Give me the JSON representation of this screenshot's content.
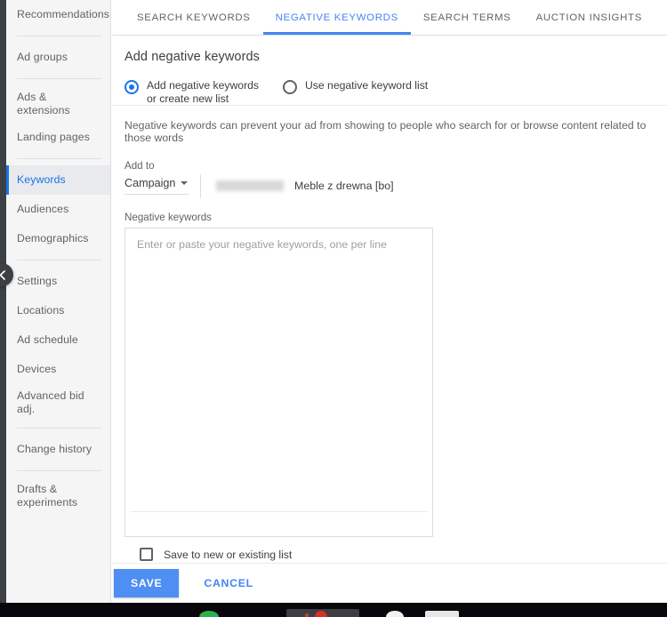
{
  "sidebar": {
    "groups": [
      {
        "items": [
          {
            "label": "Recommendations",
            "active": false
          }
        ]
      },
      {
        "items": [
          {
            "label": "Ad groups",
            "active": false
          }
        ]
      },
      {
        "items": [
          {
            "label": "Ads & extensions",
            "active": false
          },
          {
            "label": "Landing pages",
            "active": false
          }
        ]
      },
      {
        "items": [
          {
            "label": "Keywords",
            "active": true
          },
          {
            "label": "Audiences",
            "active": false
          },
          {
            "label": "Demographics",
            "active": false
          }
        ]
      },
      {
        "items": [
          {
            "label": "Settings",
            "active": false
          },
          {
            "label": "Locations",
            "active": false
          },
          {
            "label": "Ad schedule",
            "active": false
          },
          {
            "label": "Devices",
            "active": false
          },
          {
            "label": "Advanced bid adj.",
            "active": false
          }
        ]
      },
      {
        "items": [
          {
            "label": "Change history",
            "active": false
          }
        ]
      },
      {
        "items": [
          {
            "label": "Drafts & experiments",
            "active": false
          }
        ]
      }
    ],
    "collapse_handle_icon": "chevron-left-icon"
  },
  "tabs": [
    {
      "label": "SEARCH KEYWORDS",
      "active": false
    },
    {
      "label": "NEGATIVE KEYWORDS",
      "active": true
    },
    {
      "label": "SEARCH TERMS",
      "active": false
    },
    {
      "label": "AUCTION INSIGHTS",
      "active": false
    }
  ],
  "panel": {
    "title": "Add negative keywords",
    "radio_options": [
      {
        "label": "Add negative keywords or create new list",
        "selected": true
      },
      {
        "label": "Use negative keyword list",
        "selected": false
      }
    ],
    "helper_text": "Negative keywords can prevent your ad from showing to people who search for or browse content related to those words",
    "add_to": {
      "label": "Add to",
      "scope_value": "Campaign",
      "caret_icon": "chevron-down-icon",
      "campaign_name": "Meble z drewna [bo]"
    },
    "negative_keywords": {
      "label": "Negative keywords",
      "placeholder": "Enter or paste your negative keywords, one per line",
      "value": ""
    },
    "save_to_list": {
      "label": "Save to new or existing list",
      "checked": false
    }
  },
  "footer": {
    "save_label": "SAVE",
    "cancel_label": "CANCEL"
  },
  "colors": {
    "accent_blue": "#4285f4",
    "active_nav_blue": "#1a73e8",
    "save_button": "#4f8ef2",
    "sidebar_bg": "#f5f5f5",
    "text_primary": "#3c4043",
    "text_secondary": "#5f6368",
    "placeholder": "#9aa0a6",
    "divider": "#dadce0",
    "taskbar_bg": "#08080c"
  }
}
